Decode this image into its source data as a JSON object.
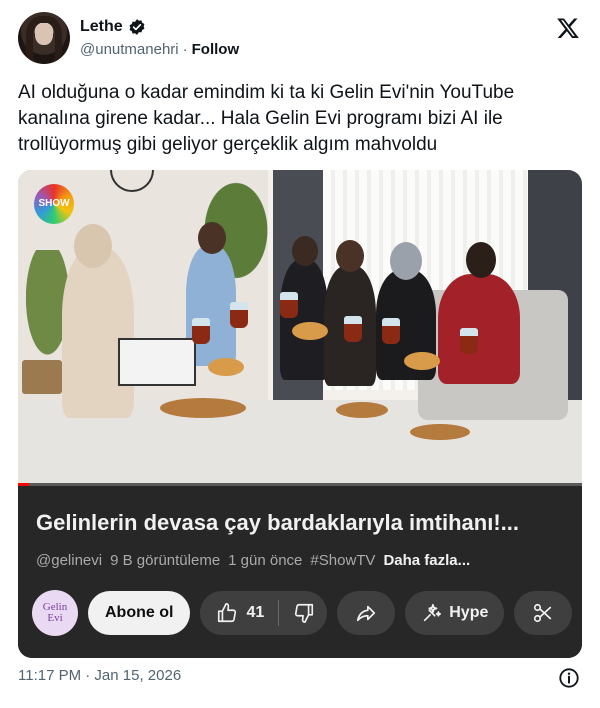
{
  "author": {
    "name": "Lethe",
    "handle": "@unutmanehri",
    "follow_label": "Follow",
    "separator": "·"
  },
  "tweet": {
    "text": "AI olduğuna o kadar emindim ki ta ki Gelin Evi'nin YouTube kanalına girene kadar... Hala Gelin Evi programı bizi AI ile trollüyormuş gibi geliyor gerçeklik algım mahvoldu",
    "timestamp": "11:17 PM · Jan 15, 2026"
  },
  "video": {
    "watermark": "SHOW",
    "progress": 0.02,
    "title": "Gelinlerin devasa çay bardaklarıyla imtihanı!...",
    "channel": "@gelinevi",
    "views": "9 B görüntüleme",
    "age": "1 gün önce",
    "hashtag": "#ShowTV",
    "more_label": "Daha fazla...",
    "channel_logo_line1": "Gelin",
    "channel_logo_line2": "Evi",
    "subscribe_label": "Abone ol",
    "like_count": "41",
    "hype_label": "Hype"
  },
  "colors": {
    "accent_red": "#ff0000",
    "panel_bg": "#272727",
    "pill_bg": "#3f3f3f"
  },
  "icons": [
    "verified-badge-icon",
    "x-logo-icon",
    "thumbs-up-icon",
    "thumbs-down-icon",
    "share-icon",
    "hype-icon",
    "scissors-icon",
    "info-icon"
  ]
}
